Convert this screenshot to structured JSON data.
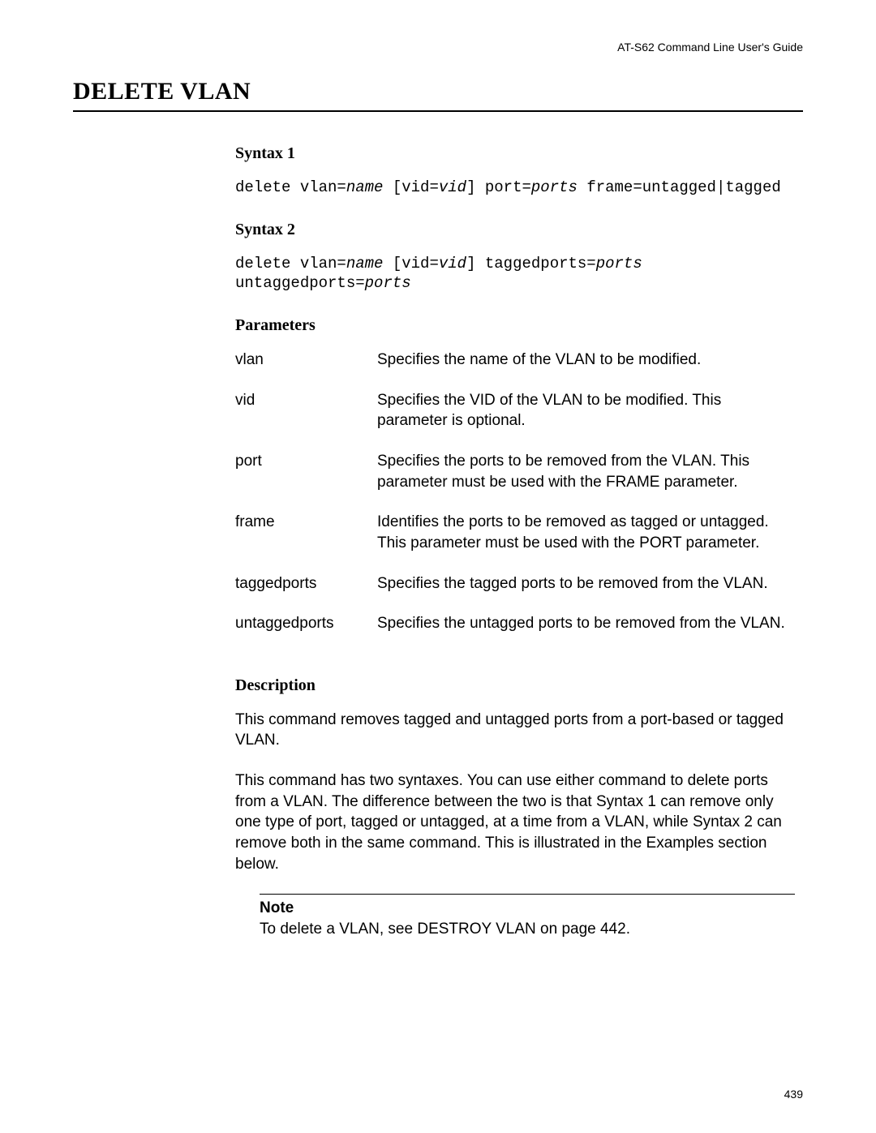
{
  "running_head": "AT-S62 Command Line User's Guide",
  "section_title": "DELETE VLAN",
  "syntax1": {
    "heading": "Syntax 1",
    "s1": "delete vlan=",
    "v1": "name",
    "s2": " [vid=",
    "v2": "vid",
    "s3": "] port=",
    "v3": "ports",
    "s4": " frame=untagged|tagged"
  },
  "syntax2": {
    "heading": "Syntax 2",
    "s1": "delete vlan=",
    "v1": "name",
    "s2": " [vid=",
    "v2": "vid",
    "s3": "] taggedports=",
    "v3": "ports",
    "s4": " untaggedports=",
    "v4": "ports"
  },
  "parameters": {
    "heading": "Parameters",
    "rows": [
      {
        "name": "vlan",
        "desc": "Specifies the name of the VLAN to be modified."
      },
      {
        "name": "vid",
        "desc": "Specifies the VID of the VLAN to be modified. This parameter is optional."
      },
      {
        "name": "port",
        "desc": "Specifies the ports to be removed from the VLAN. This parameter must be used with the FRAME parameter."
      },
      {
        "name": "frame",
        "desc": "Identifies the ports to be removed as tagged or untagged. This parameter must be used with the PORT parameter."
      },
      {
        "name": "taggedports",
        "desc": "Specifies the tagged ports to be removed from the VLAN."
      },
      {
        "name": "untaggedports",
        "desc": "Specifies the untagged ports to be removed from the VLAN."
      }
    ]
  },
  "description": {
    "heading": "Description",
    "p1": "This command removes tagged and untagged ports from a port-based or tagged VLAN.",
    "p2": "This command has two syntaxes. You can use either command to delete ports from a VLAN. The difference between the two is that Syntax 1 can remove only one type of port, tagged or untagged, at a time from a VLAN, while Syntax 2 can remove both in the same command. This is illustrated in the Examples section below."
  },
  "note": {
    "label": "Note",
    "text": "To delete a VLAN, see DESTROY VLAN on page 442."
  },
  "page_number": "439"
}
